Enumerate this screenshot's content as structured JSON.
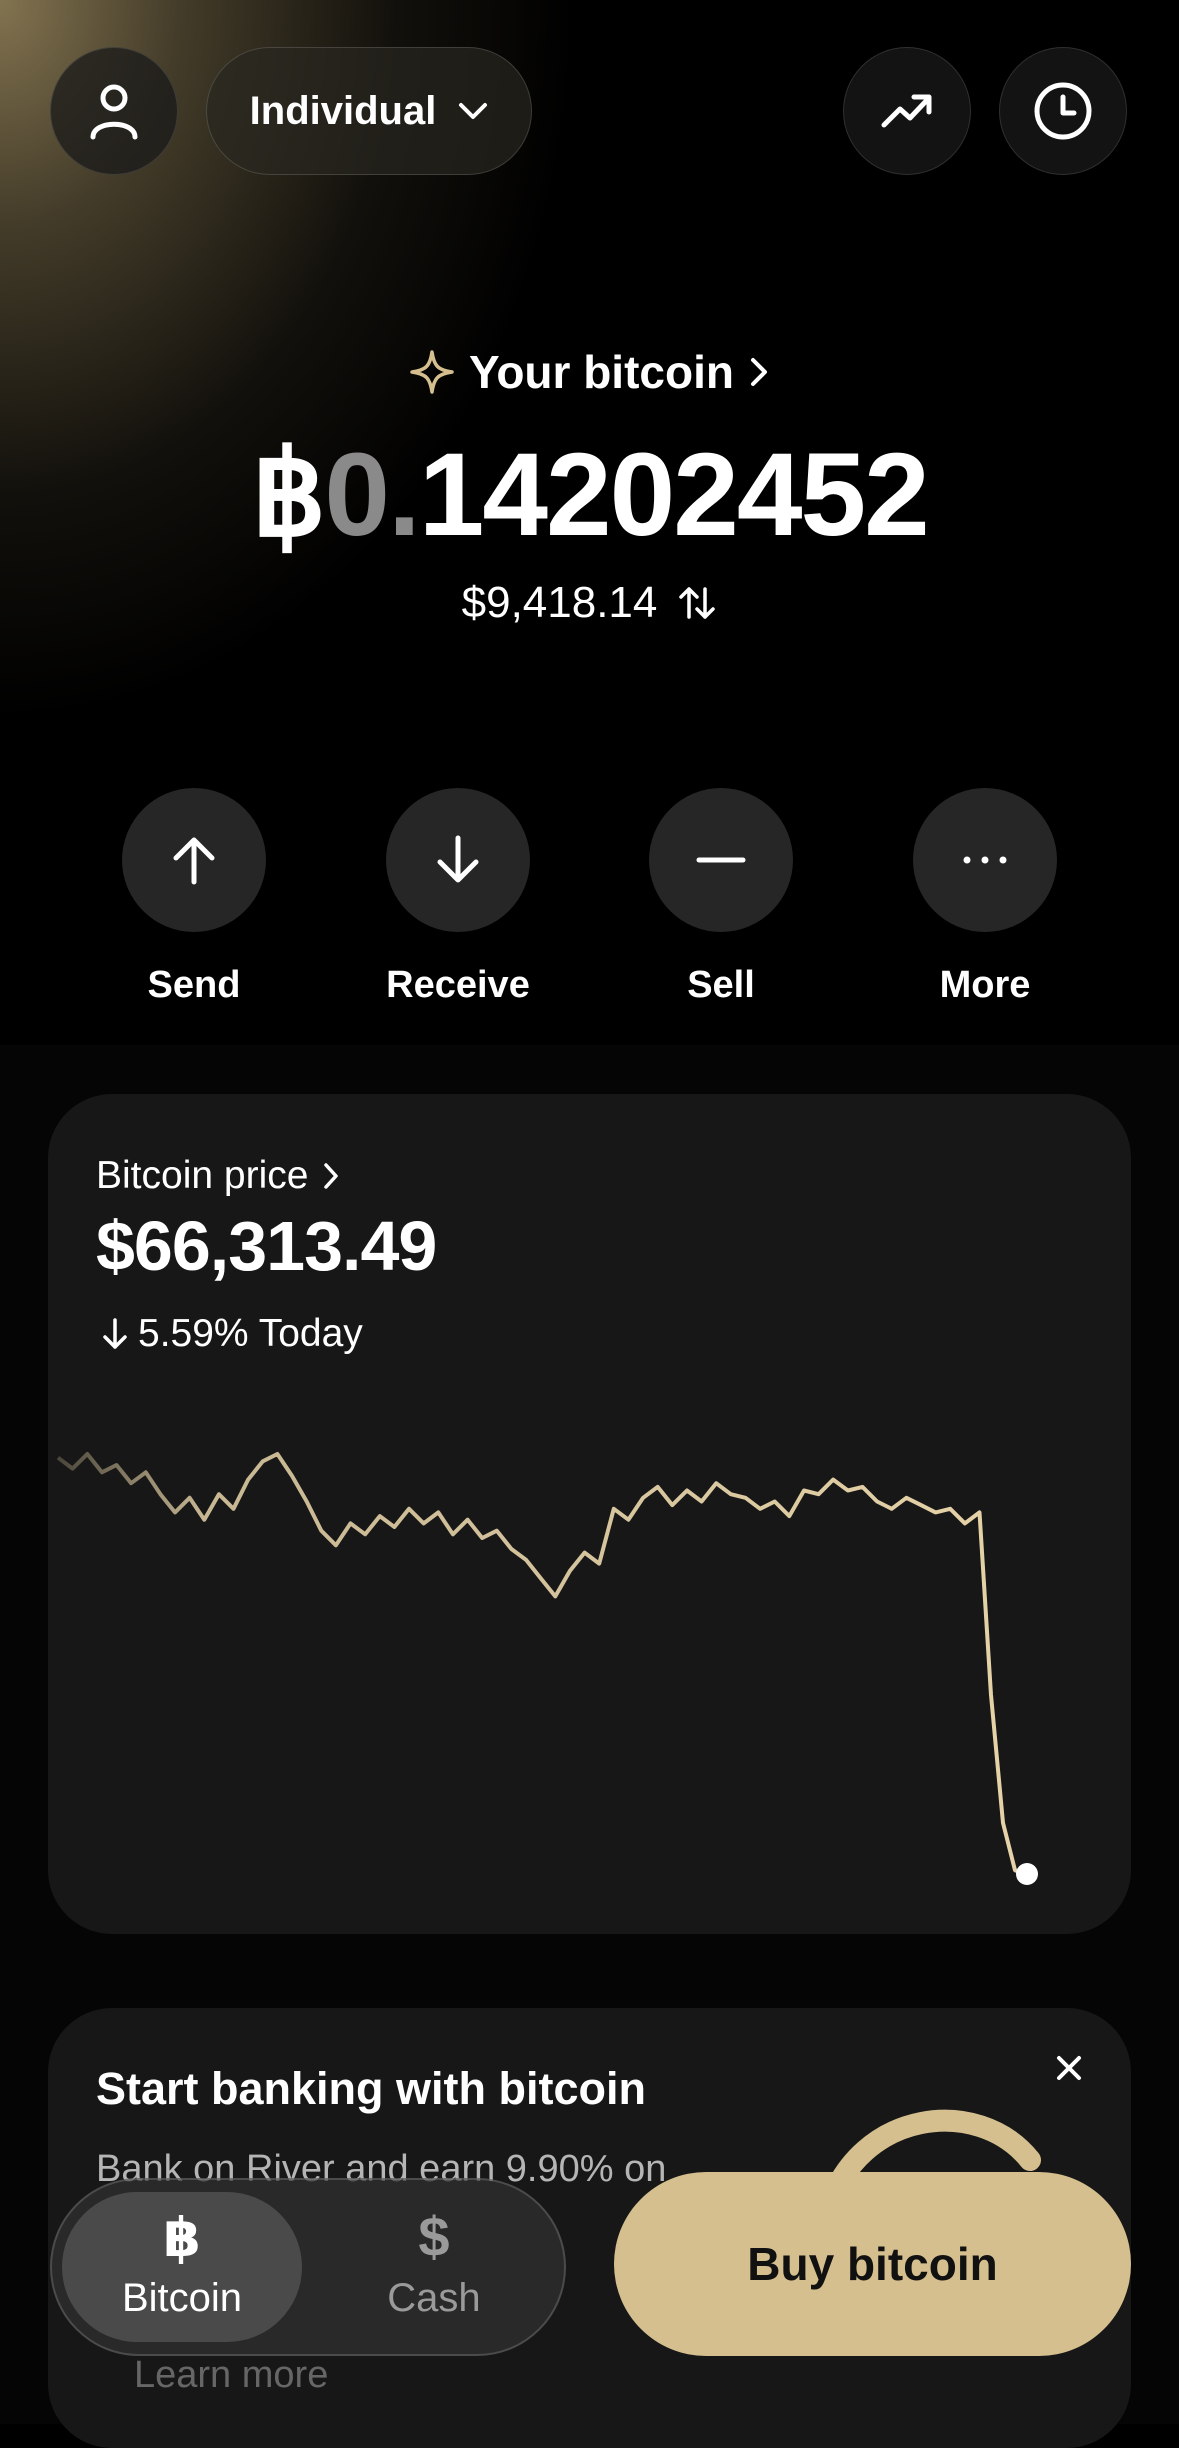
{
  "header": {
    "account_selector_label": "Individual",
    "profile_icon": "person-icon",
    "trend_icon": "trending-up-icon",
    "history_icon": "clock-icon"
  },
  "balance": {
    "section_label": "Your bitcoin",
    "btc_symbol": "฿",
    "btc_amount_dim": "0.",
    "btc_amount_main": "14202452",
    "fiat_value": "$9,418.14"
  },
  "actions": [
    {
      "label": "Send",
      "icon": "arrow-up-icon"
    },
    {
      "label": "Receive",
      "icon": "arrow-down-icon"
    },
    {
      "label": "Sell",
      "icon": "minus-icon"
    },
    {
      "label": "More",
      "icon": "more-icon"
    }
  ],
  "price_card": {
    "title": "Bitcoin price",
    "price": "$66,313.49",
    "change_text": "5.59% Today",
    "change_direction": "down"
  },
  "chart_data": {
    "type": "line",
    "y": [
      100.0,
      99.7,
      100.1,
      99.6,
      99.8,
      99.3,
      99.6,
      99.0,
      98.5,
      98.9,
      98.3,
      99.0,
      98.6,
      99.4,
      99.9,
      100.1,
      99.5,
      98.8,
      98.0,
      97.6,
      98.2,
      97.9,
      98.4,
      98.1,
      98.6,
      98.2,
      98.5,
      97.9,
      98.3,
      97.8,
      98.0,
      97.5,
      97.2,
      96.7,
      96.2,
      96.9,
      97.4,
      97.1,
      98.6,
      98.3,
      98.9,
      99.2,
      98.7,
      99.1,
      98.8,
      99.3,
      99.0,
      98.9,
      98.6,
      98.8,
      98.4,
      99.1,
      99.0,
      99.4,
      99.1,
      99.2,
      98.8,
      98.6,
      98.9,
      98.7,
      98.5,
      98.6,
      98.2,
      98.5,
      93.5,
      90.0,
      88.7,
      88.6
    ],
    "color": "#e6d3a8",
    "end_marker": true
  },
  "promo": {
    "title": "Start banking with bitcoin",
    "subtitle": "Bank on River and earn 9.90% on",
    "learn_more": "Learn more"
  },
  "tabbar": {
    "tabs": [
      {
        "label": "Bitcoin",
        "icon": "bitcoin-icon",
        "active": true
      },
      {
        "label": "Cash",
        "icon": "dollar-icon",
        "active": false
      }
    ],
    "buy_label": "Buy bitcoin"
  },
  "colors": {
    "accent": "#d5bf8e",
    "chart_line": "#e6d3a8",
    "card": "#171717",
    "background": "#000000"
  }
}
